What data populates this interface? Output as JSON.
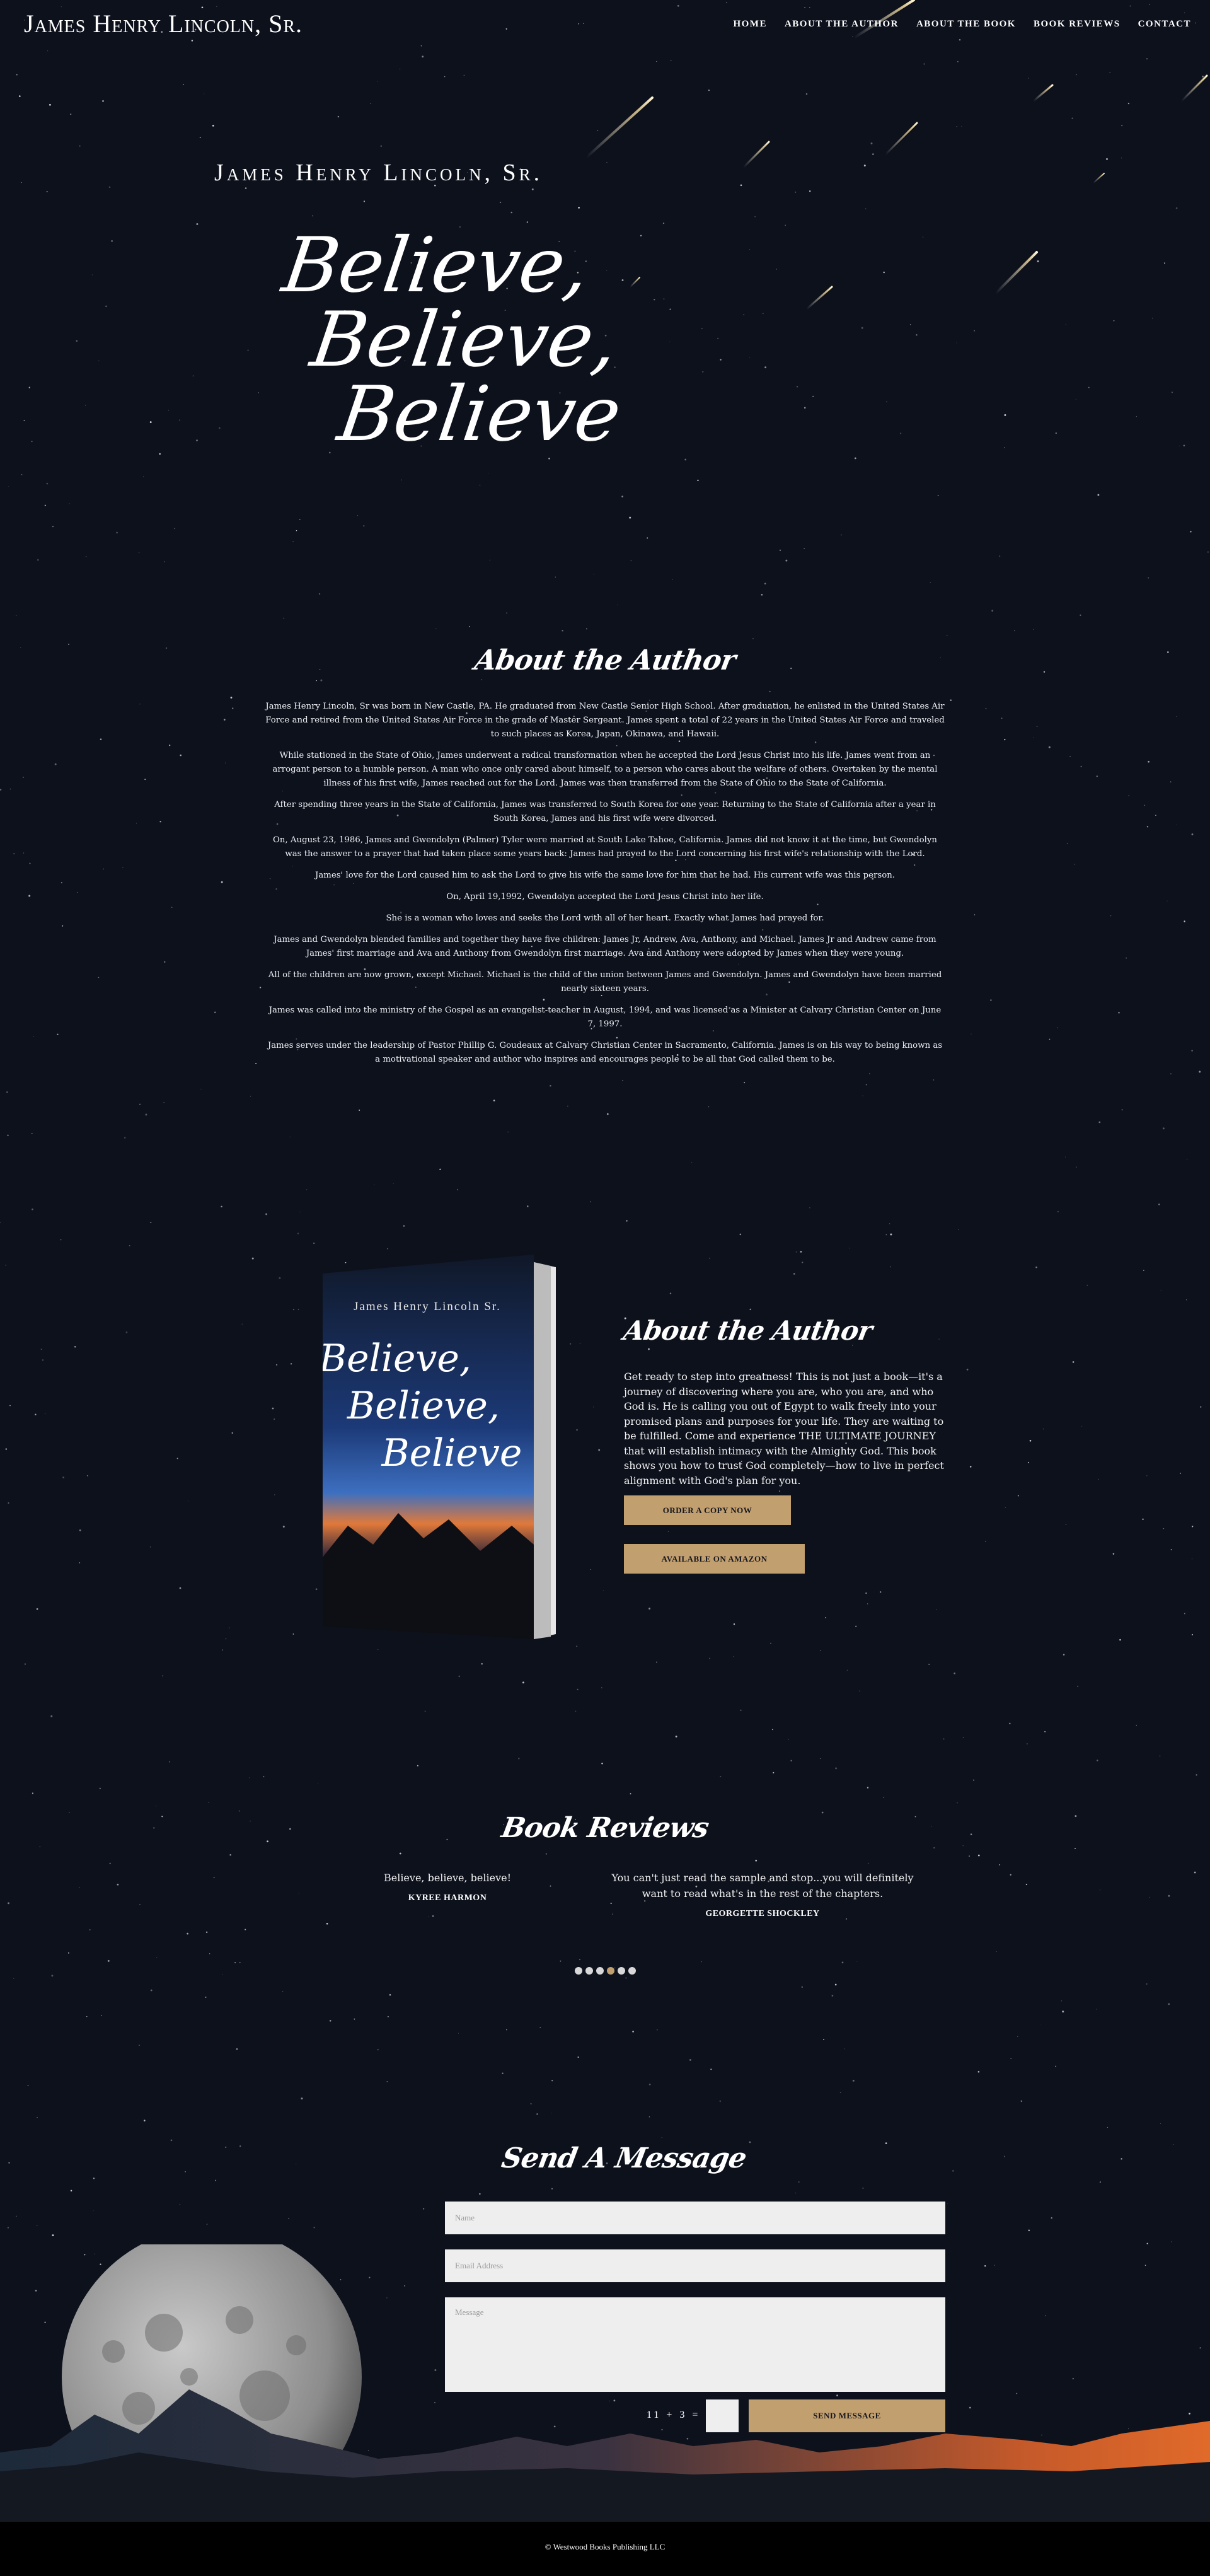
{
  "header": {
    "site_title": "James Henry Lincoln, Sr.",
    "nav": [
      "HOME",
      "ABOUT THE AUTHOR",
      "ABOUT THE BOOK",
      "BOOK REVIEWS",
      "CONTACT"
    ]
  },
  "hero": {
    "author": "James Henry Lincoln, Sr.",
    "title_lines": [
      "Believe,",
      "Believe,",
      "Believe"
    ]
  },
  "about": {
    "heading": "About the Author",
    "paragraphs": [
      "James Henry Lincoln, Sr was born in New Castle, PA. He graduated from New Castle Senior High School. After graduation, he enlisted in the United States Air Force and retired from the United States Air Force in the grade of Master Sergeant. James spent a total of 22 years in the United States Air Force and traveled to such places as Korea, Japan, Okinawa, and Hawaii.",
      "While stationed in the State of Ohio, James underwent a radical transformation when he accepted the Lord Jesus Christ into his life. James went from an arrogant person to a humble person. A man who once only cared about himself, to a person who cares about the welfare of others. Overtaken by the mental illness of his first wife, James reached out for the Lord. James was then transferred from the State of Ohio to the State of California.",
      "After spending three years in the State of California, James was transferred to South Korea for one year. Returning to the State of California after a year in South Korea, James and his first wife were divorced.",
      "On, August 23, 1986, James and Gwendolyn (Palmer) Tyler were married at South Lake Tahoe, California. James did not know it at the time, but Gwendolyn was the answer to a prayer that had taken place some years back: James had prayed to the Lord concerning his first wife's relationship with the Lord.",
      "James' love for the Lord caused him to ask the Lord to give his wife the same love for him that he had. His current wife was this person.",
      "On, April 19,1992, Gwendolyn accepted the Lord Jesus Christ into her life.",
      "She is a woman who loves and seeks the Lord with all of her heart. Exactly what James had prayed for.",
      "James and Gwendolyn blended families and together they have five children: James Jr, Andrew, Ava, Anthony, and Michael. James Jr and Andrew came from James' first marriage and Ava and Anthony from Gwendolyn first marriage. Ava and Anthony were adopted by James when they were young.",
      "All of the children are now grown, except Michael. Michael is the child of the union between James and Gwendolyn. James and Gwendolyn have been married nearly sixteen years.",
      "James was called into the ministry of the Gospel as an evangelist-teacher in August, 1994, and was licensed as a Minister at Calvary Christian Center on June 7, 1997.",
      "James serves under the leadership of Pastor Phillip G. Goudeaux at Calvary Christian Center in Sacramento, California. James is on his way to being known as a motivational speaker and author who inspires and encourages people to be all that God called them to be."
    ]
  },
  "book": {
    "cover_author": "James Henry Lincoln Sr.",
    "cover_title": [
      "Believe,",
      "Believe,",
      "Believe"
    ],
    "heading": "About the Author",
    "description": "Get ready to step into greatness! This is not just a book—it's a journey of discovering where you are, who you are, and who God is. He is calling you out of Egypt to walk freely into your promised plans and purposes for your life. They are waiting to be fulfilled. Come and experience THE ULTIMATE JOURNEY that will establish intimacy with the Almighty God. This book shows you how to trust God completely—how to live in perfect alignment with God's plan for you.",
    "order_button": "ORDER A COPY NOW",
    "amazon_button": "AVAILABLE ON AMAZON"
  },
  "reviews": {
    "heading": "Book Reviews",
    "items": [
      {
        "quote": "Believe, believe, believe!",
        "name": "KYREE HARMON"
      },
      {
        "quote": "You can't just read the sample and stop...you will definitely want to read what's in the rest of the chapters.",
        "name": "GEORGETTE SHOCKLEY"
      }
    ],
    "dots": 6,
    "active_dot_index": 3
  },
  "contact": {
    "heading": "Send A Message",
    "name_placeholder": "Name",
    "email_placeholder": "Email Address",
    "message_placeholder": "Message",
    "captcha": "11 + 3 =",
    "send_button": "SEND MESSAGE"
  },
  "footer": {
    "copyright": "© Westwood Books Publishing LLC"
  },
  "colors": {
    "background": "#0d111c",
    "accent": "#c29f6f",
    "field": "#eeeeee"
  }
}
